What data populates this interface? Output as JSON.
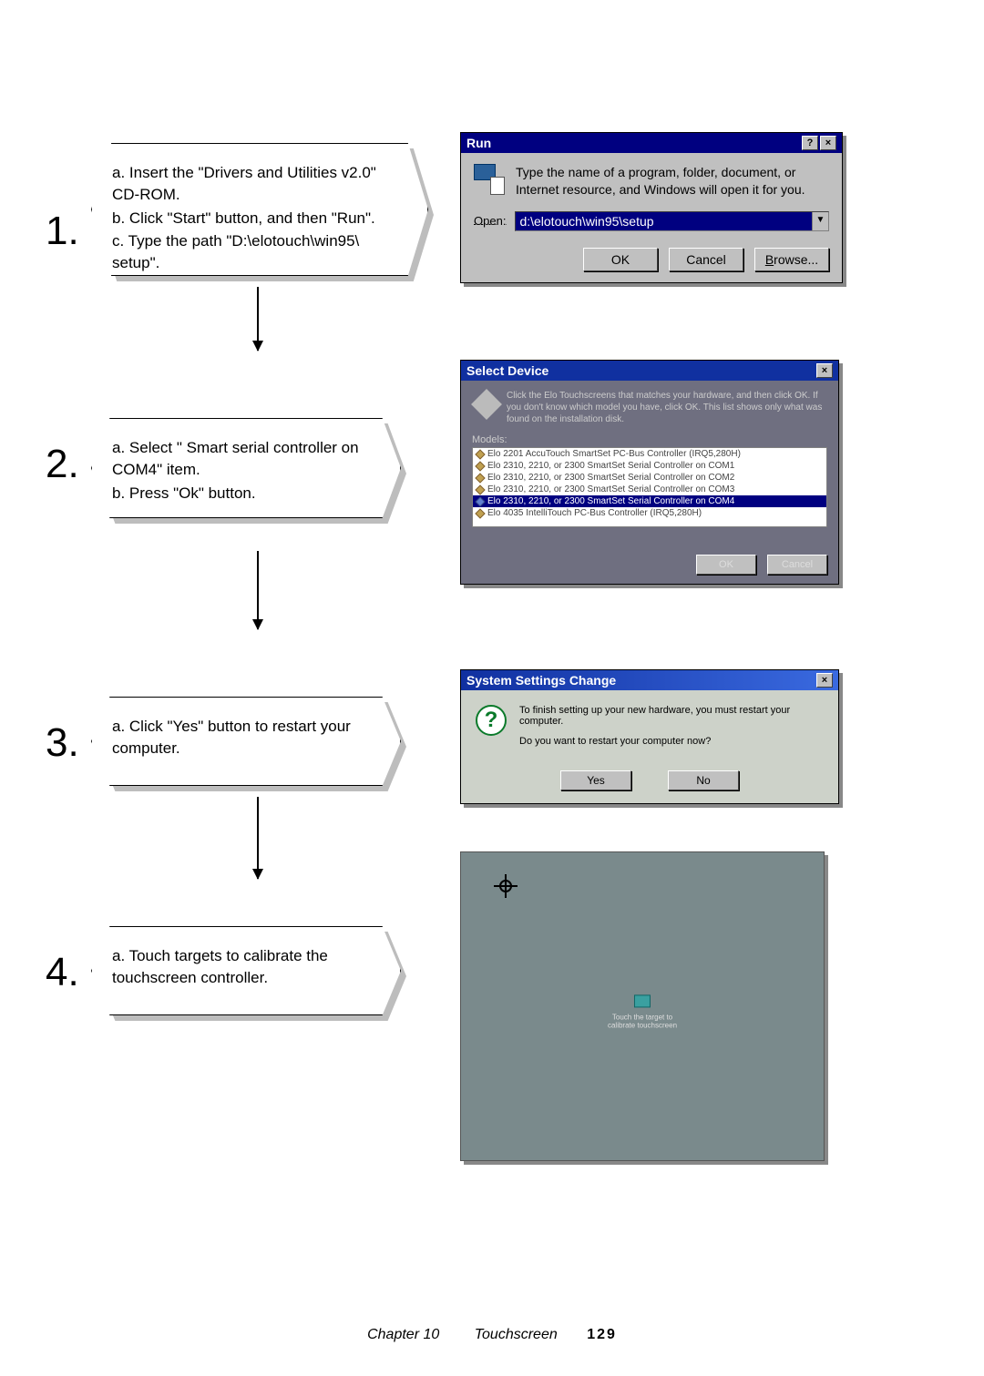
{
  "steps": [
    {
      "num": "1.",
      "lines": [
        "a. Insert the \"Drivers and Utilities v2.0\" CD-ROM.",
        "b. Click \"Start\" button, and then \"Run\".",
        "c. Type the path \"D:\\elotouch\\win95\\ setup\"."
      ]
    },
    {
      "num": "2.",
      "lines": [
        "a. Select \" Smart serial controller on COM4\" item.",
        "b. Press \"Ok\" button."
      ]
    },
    {
      "num": "3.",
      "lines": [
        "a. Click \"Yes\" button to restart your computer."
      ]
    },
    {
      "num": "4.",
      "lines": [
        "a. Touch targets to calibrate the touchscreen controller."
      ]
    }
  ],
  "run_dialog": {
    "title": "Run",
    "help_glyph": "?",
    "close_glyph": "×",
    "description": "Type the name of a program, folder, document, or Internet resource, and Windows will open it for you.",
    "open_label": "Open:",
    "open_value": "d:\\elotouch\\win95\\setup",
    "ok": "OK",
    "cancel": "Cancel",
    "browse": "Browse..."
  },
  "select_device": {
    "title": "Select Device",
    "close_glyph": "×",
    "info": "Click the Elo Touchscreens that matches your hardware, and then click OK. If you don't know which model you have, click OK. This list shows only what was found on the installation disk.",
    "models_label": "Models:",
    "items": [
      "Elo 2201 AccuTouch SmartSet PC-Bus Controller (IRQ5,280H)",
      "Elo 2310, 2210, or 2300 SmartSet Serial Controller on COM1",
      "Elo 2310, 2210, or 2300 SmartSet Serial Controller on COM2",
      "Elo 2310, 2210, or 2300 SmartSet Serial Controller on COM3",
      "Elo 2310, 2210, or 2300 SmartSet Serial Controller on COM4",
      "Elo 4035 IntelliTouch PC-Bus Controller (IRQ5,280H)"
    ],
    "selected_index": 4,
    "ok": "OK",
    "cancel": "Cancel"
  },
  "system_settings_change": {
    "title": "System Settings Change",
    "close_glyph": "×",
    "line1": "To finish setting up your new hardware, you must restart your computer.",
    "line2": "Do you want to restart your computer now?",
    "yes": "Yes",
    "no": "No"
  },
  "calibrate": {
    "caption1": "Touch the target to",
    "caption2": "calibrate touchscreen"
  },
  "footer": {
    "chapter": "Chapter 10",
    "section": "Touchscreen",
    "page": "129"
  }
}
